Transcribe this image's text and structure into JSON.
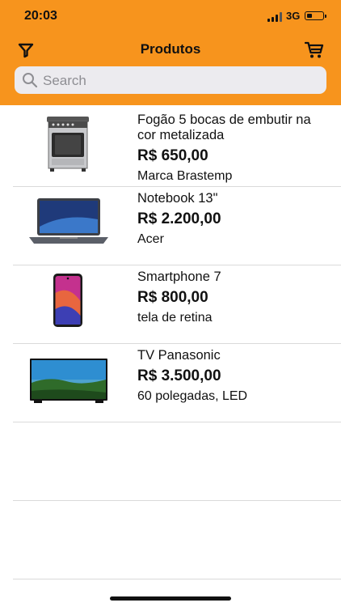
{
  "status_bar": {
    "time": "20:03",
    "network": "3G"
  },
  "nav": {
    "title": "Produtos",
    "filter_icon": "filter-icon",
    "cart_icon": "cart-icon"
  },
  "search": {
    "placeholder": "Search",
    "value": ""
  },
  "colors": {
    "header": "#F7941D",
    "search_bg": "#ECEBEF",
    "separator": "#DADADA"
  },
  "products": [
    {
      "name": "Fogão 5 bocas de embutir na cor metalizada",
      "price": "R$ 650,00",
      "description": "Marca Brastemp",
      "image": "stove-image"
    },
    {
      "name": "Notebook 13\"",
      "price": "R$ 2.200,00",
      "description": "Acer",
      "image": "laptop-image"
    },
    {
      "name": "Smartphone 7",
      "price": "R$ 800,00",
      "description": "tela de retina",
      "image": "smartphone-image"
    },
    {
      "name": "TV Panasonic",
      "price": "R$ 3.500,00",
      "description": "60 polegadas, LED",
      "image": "tv-image"
    }
  ]
}
